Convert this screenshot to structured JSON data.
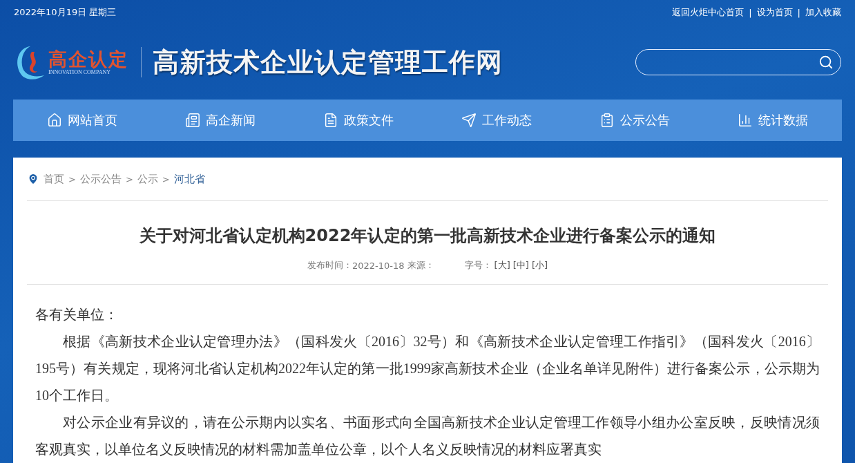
{
  "top_bar": {
    "date": "2022年10月19日 星期三",
    "links": [
      "返回火炬中心首页",
      "设为首页",
      "加入收藏"
    ],
    "separator": "|"
  },
  "header": {
    "logo_text": "高企认定",
    "logo_subtext": "INNOVATION COMPANY",
    "site_title": "高新技术企业认定管理工作网"
  },
  "nav": [
    {
      "label": "网站首页"
    },
    {
      "label": "高企新闻"
    },
    {
      "label": "政策文件"
    },
    {
      "label": "工作动态"
    },
    {
      "label": "公示公告"
    },
    {
      "label": "统计数据"
    }
  ],
  "breadcrumb": {
    "items": [
      "首页",
      "公示公告",
      "公示",
      "河北省"
    ],
    "separator": ">"
  },
  "article": {
    "title": "关于对河北省认定机构2022年认定的第一批高新技术企业进行备案公示的通知",
    "publish_label": "发布时间：",
    "publish_date": "2022-10-18",
    "source_label": "来源：",
    "font_size_label": "字号：",
    "font_sizes": [
      "[大]",
      "[中]",
      "[小]"
    ],
    "paragraphs": [
      {
        "text": "各有关单位：",
        "kind": "salutation"
      },
      {
        "text": "根据《高新技术企业认定管理办法》（国科发火〔2016〕32号）和《高新技术企业认定管理工作指引》（国科发火〔2016〕195号）有关规定，现将河北省认定机构2022年认定的第一批1999家高新技术企业（企业名单详见附件）进行备案公示，公示期为10个工作日。",
        "kind": "body"
      },
      {
        "text": "对公示企业有异议的，请在公示期内以实名、书面形式向全国高新技术企业认定管理工作领导小组办公室反映，反映情况须客观真实，以单位名义反映情况的材料需加盖单位公章，以个人名义反映情况的材料应署真实",
        "kind": "body"
      }
    ]
  }
}
